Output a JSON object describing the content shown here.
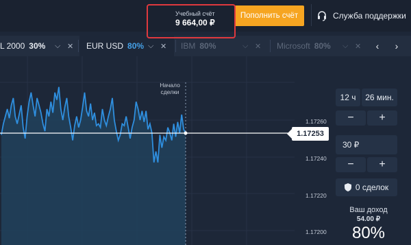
{
  "header": {
    "account_title": "Учебный счёт",
    "account_balance": "9 664,00 ₽",
    "deposit_label": "Пополнить счёт",
    "support_label": "Служба поддержки"
  },
  "tabs": [
    {
      "name": "L 2000",
      "percent": "30%",
      "state": "normal"
    },
    {
      "name": "EUR USD",
      "percent": "80%",
      "state": "active"
    },
    {
      "name": "IBM",
      "percent": "80%",
      "state": "disabled"
    },
    {
      "name": "Microsoft",
      "percent": "80%",
      "state": "disabled"
    }
  ],
  "chart": {
    "start_label_line1": "Начало",
    "start_label_line2": "сделки",
    "current_price": "1.17253",
    "y_ticks": [
      "1.17260",
      "1.17240",
      "1.17220",
      "1.17200"
    ],
    "line_color": "#2f8fdf",
    "fill_color": "#21405a"
  },
  "chart_data": {
    "type": "line",
    "title": "",
    "xlabel": "",
    "ylabel": "",
    "ylim": [
      1.1719,
      1.1728
    ],
    "series": [
      {
        "values": [
          1.17252,
          1.17258,
          1.17262,
          1.17266,
          1.17261,
          1.17268,
          1.17272,
          1.17262,
          1.17258,
          1.17263,
          1.17268,
          1.17256,
          1.1725,
          1.17262,
          1.1727,
          1.17275,
          1.17268,
          1.17262,
          1.17272,
          1.17268,
          1.17264,
          1.17258,
          1.17254,
          1.17266,
          1.17262,
          1.1727,
          1.17264,
          1.17275,
          1.17271,
          1.17278,
          1.17266,
          1.1726,
          1.17267,
          1.17272,
          1.17262,
          1.17256,
          1.17249,
          1.17257,
          1.17262,
          1.17256,
          1.1726,
          1.17267,
          1.17275,
          1.17265,
          1.17262,
          1.17269,
          1.1726,
          1.17264,
          1.17257,
          1.17258,
          1.17256,
          1.17266,
          1.1726,
          1.17257,
          1.17262,
          1.17266,
          1.17272,
          1.1726,
          1.17254,
          1.17249,
          1.17252,
          1.17258,
          1.17257,
          1.17262,
          1.17256,
          1.1725,
          1.17256,
          1.1726,
          1.1727,
          1.17266,
          1.1726,
          1.17265,
          1.17259,
          1.17265,
          1.17255,
          1.17258,
          1.17253,
          1.17237,
          1.17243,
          1.17237,
          1.17252,
          1.17245,
          1.17251,
          1.17249,
          1.17256,
          1.17253,
          1.17249,
          1.17258,
          1.17251,
          1.17259,
          1.17253,
          1.17263,
          1.17255,
          1.17253
        ]
      }
    ]
  },
  "panel": {
    "hours": "12 ч",
    "minutes": "26 мин.",
    "amount": "30 ₽",
    "deals": "0 сделок",
    "earn_label": "Ваш доход",
    "earn_amount": "54.00 ₽",
    "earn_percent": "80%",
    "minus": "−",
    "plus": "+"
  }
}
